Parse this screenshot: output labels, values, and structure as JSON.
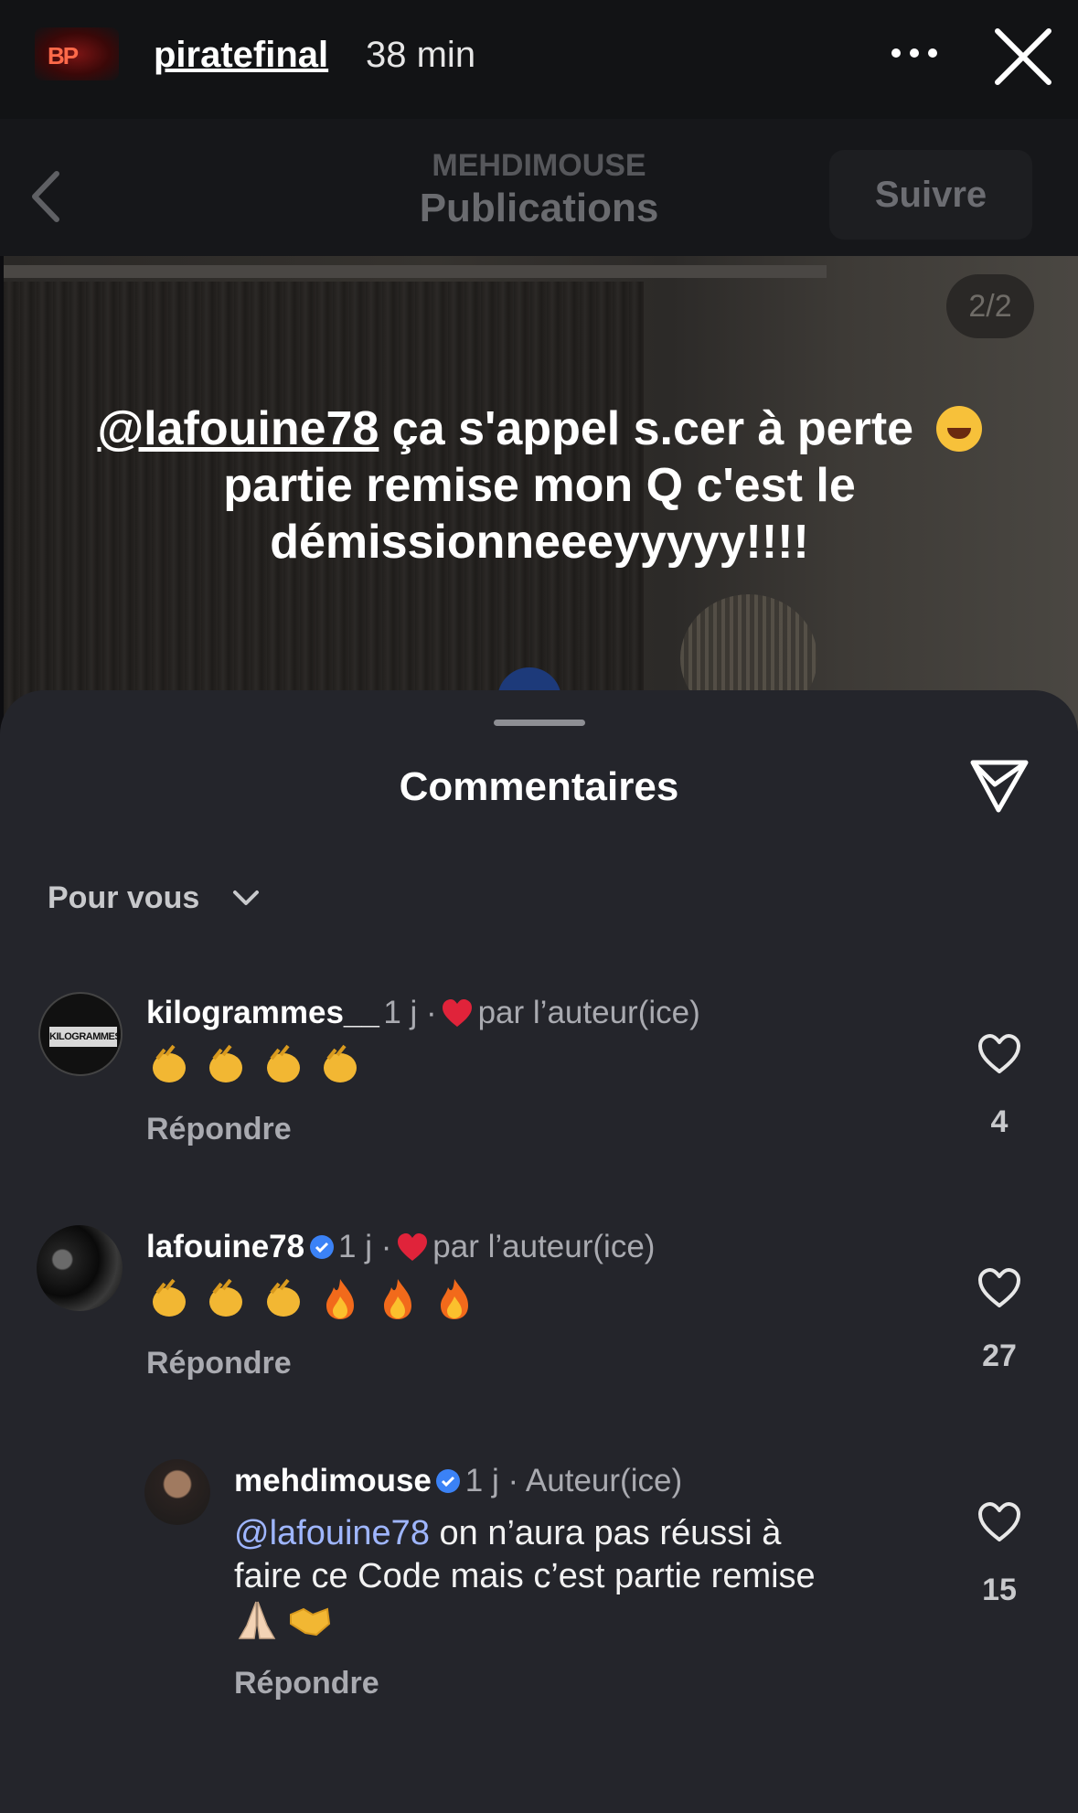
{
  "story": {
    "username": "piratefinal",
    "time": "38 min"
  },
  "post_header": {
    "account": "MEHDIMOUSE",
    "section": "Publications",
    "follow_label": "Suivre"
  },
  "post": {
    "counter": "2/2",
    "caption_mention": "@lafouine78",
    "caption_line1": " ça s'appel s.cer à perte ",
    "caption_line2": "partie remise mon Q c'est le",
    "caption_line3": "démissionneeeyyyyy!!!!"
  },
  "comments_sheet": {
    "title": "Commentaires",
    "sort_label": "Pour vous"
  },
  "comments": [
    {
      "username": "kilogrammes__",
      "avatar_text": "KILOGRAMMES",
      "meta_time": "1 j ·",
      "meta_liked": "par l’auteur(ice)",
      "emojis": [
        "clap",
        "clap",
        "clap",
        "clap"
      ],
      "reply_label": "Répondre",
      "likes": "4"
    },
    {
      "username": "lafouine78",
      "verified": true,
      "meta_time": "1 j ·",
      "meta_liked": "par l’auteur(ice)",
      "emojis": [
        "clap",
        "clap",
        "clap",
        "fire",
        "fire",
        "fire"
      ],
      "reply_label": "Répondre",
      "likes": "27"
    },
    {
      "username": "mehdimouse",
      "verified": true,
      "meta": "1 j · Auteur(ice)",
      "mention": "@lafouine78",
      "text_line1": " on n’aura pas réussi à",
      "text_line2": "faire ce Code mais c’est partie remise",
      "emojis": [
        "praying-hands",
        "handshake"
      ],
      "reply_label": "Répondre",
      "likes": "15"
    }
  ],
  "colors": {
    "sheet_bg": "#24252b",
    "mention": "#9fb6ff",
    "heart_red": "#e0233a",
    "verified_blue": "#3b82f6"
  }
}
